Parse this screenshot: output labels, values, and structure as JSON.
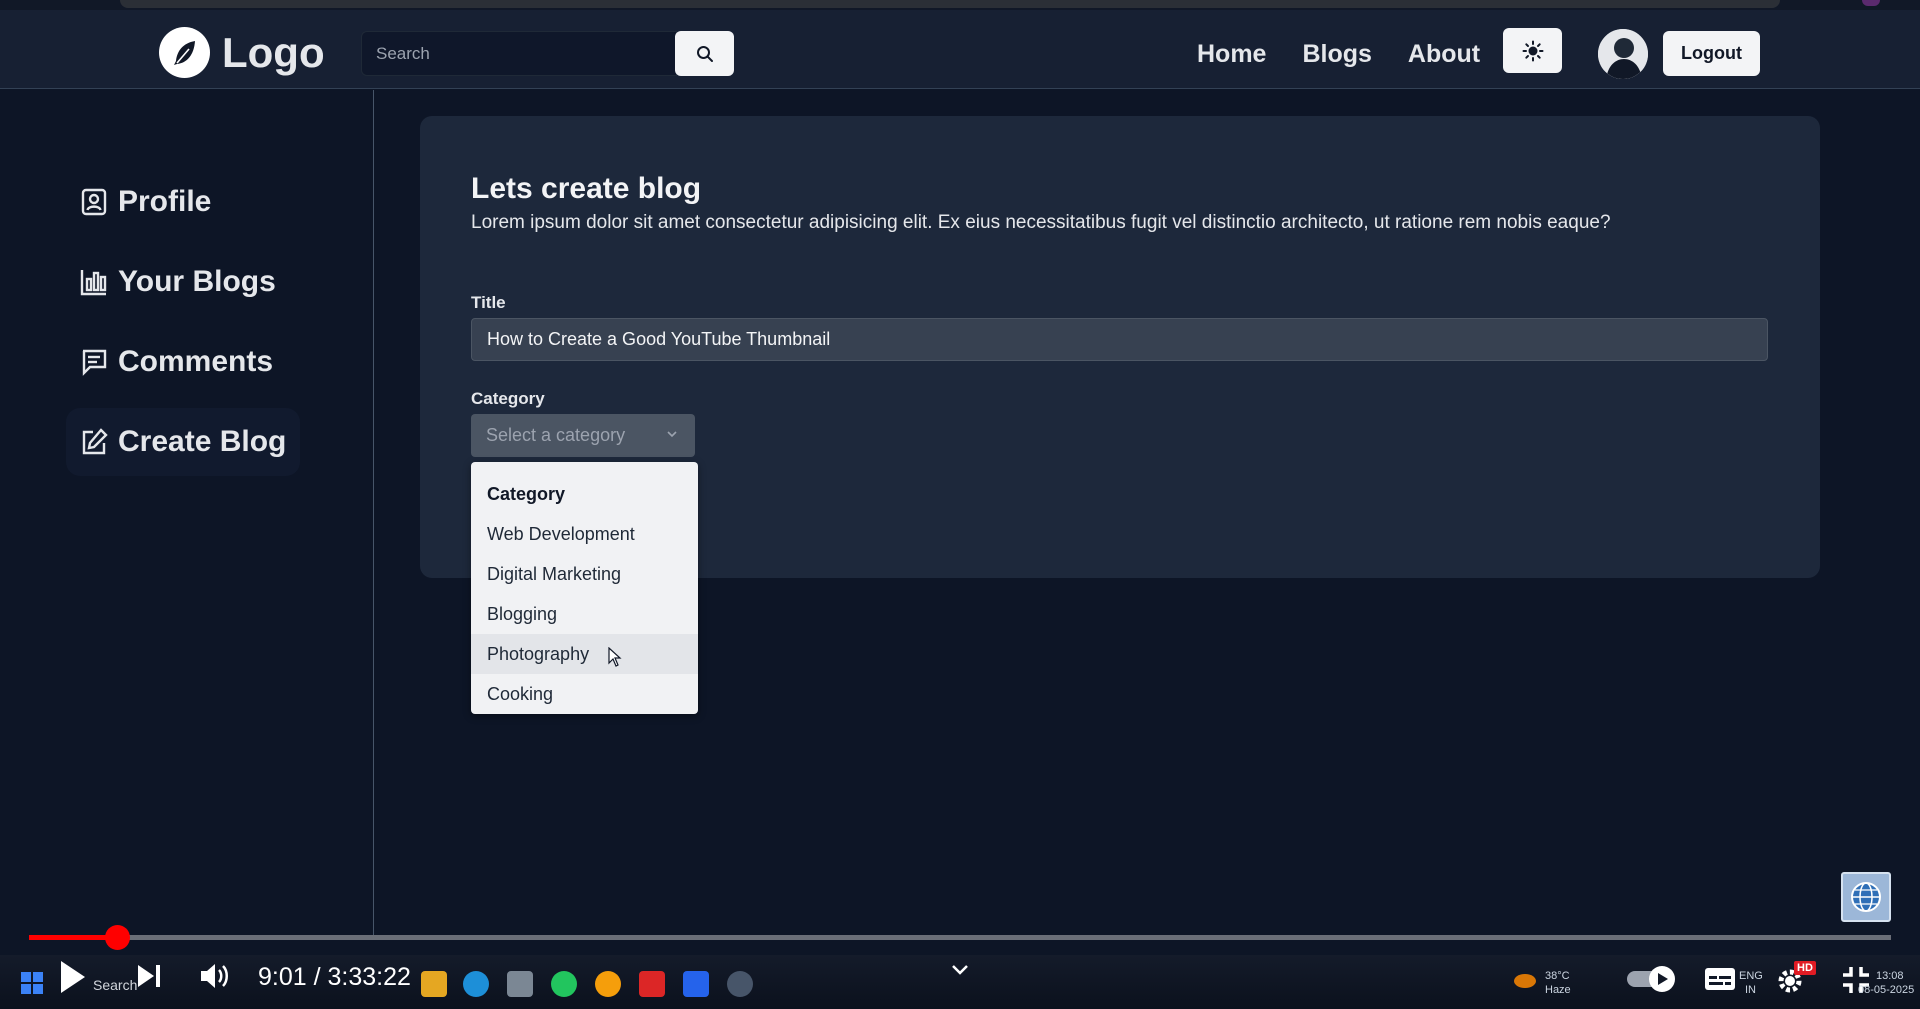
{
  "navbar": {
    "logo_text": "Logo",
    "search_placeholder": "Search",
    "links": [
      "Home",
      "Blogs",
      "About"
    ],
    "logout_label": "Logout"
  },
  "sidebar": {
    "items": [
      {
        "label": "Profile",
        "icon": "profile-icon"
      },
      {
        "label": "Your Blogs",
        "icon": "bar-chart-icon"
      },
      {
        "label": "Comments",
        "icon": "comment-icon"
      },
      {
        "label": "Create Blog",
        "icon": "edit-icon",
        "active": true
      }
    ]
  },
  "form": {
    "heading": "Lets create blog",
    "description": "Lorem ipsum dolor sit amet consectetur adipisicing elit. Ex eius necessitatibus fugit vel distinctio architecto, ut ratione rem nobis eaque?",
    "title_label": "Title",
    "title_value": "How to Create a Good YouTube Thumbnail",
    "category_label": "Category",
    "category_placeholder": "Select a category",
    "category_options": [
      "Category",
      "Web Development",
      "Digital Marketing",
      "Blogging",
      "Photography",
      "Cooking"
    ],
    "hovered_option": "Photography"
  },
  "player": {
    "time": "9:01 / 3:33:22",
    "progress_fraction": 0.0475,
    "taskbar_search": "Search",
    "weather": "38°C",
    "weather_desc": "Haze",
    "lang": "ENG",
    "region": "IN",
    "clock_time": "13:08",
    "clock_date": "08-05-2025",
    "hd_badge": "HD"
  },
  "colors": {
    "background": "#0d1526",
    "navbar": "#172033",
    "card": "#1d283b",
    "progress": "#ff0000"
  }
}
